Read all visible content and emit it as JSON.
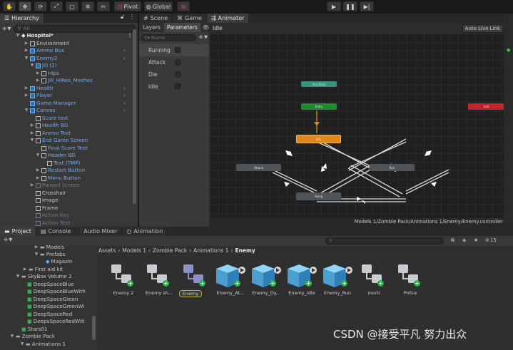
{
  "toolbar": {
    "pivot": "Pivot",
    "global": "Global"
  },
  "hierarchy": {
    "title": "Hierarchy",
    "search_placeholder": "All",
    "scene": "Hospital*",
    "items": [
      {
        "label": "Environment"
      },
      {
        "label": "Ammo Box"
      },
      {
        "label": "Enemy2"
      },
      {
        "label": "Jill (2)"
      },
      {
        "label": "Hips"
      },
      {
        "label": "Jill_HiRes_Meshes"
      },
      {
        "label": "Health"
      },
      {
        "label": "Player"
      },
      {
        "label": "Game Manager"
      },
      {
        "label": "Canvas"
      },
      {
        "label": "Score text"
      },
      {
        "label": "Health BG"
      },
      {
        "label": "Ammo Text"
      },
      {
        "label": "End Game Screen"
      },
      {
        "label": "Final Score Text"
      },
      {
        "label": "Header BG"
      },
      {
        "label": "Text (TMP)"
      },
      {
        "label": "Restart Button"
      },
      {
        "label": "Menu Button"
      },
      {
        "label": "Paused Screen"
      },
      {
        "label": "Crosshair"
      },
      {
        "label": "Image"
      },
      {
        "label": "Frame"
      },
      {
        "label": "Action Key"
      },
      {
        "label": "Action Text"
      }
    ]
  },
  "center_tabs": {
    "scene": "Scene",
    "game": "Game",
    "animator": "Animator"
  },
  "animator": {
    "layers_tab": "Layers",
    "parameters_tab": "Parameters",
    "name_placeholder": "Name",
    "parameters": [
      {
        "name": "Running"
      },
      {
        "name": "Attack"
      },
      {
        "name": "Die"
      },
      {
        "name": "Idle"
      }
    ],
    "breadcrumb": "Idle",
    "auto_live_link": "Auto Live Link",
    "states": {
      "any": "Any State",
      "entry": "Entry",
      "exit": "Exit",
      "idle": "Idle",
      "attack": "Attack",
      "run": "Run",
      "dying": "Dying"
    },
    "path": "Models 1/Zombie Pack/Animations 1/Enemy/Enemy.controller"
  },
  "bottom_tabs": {
    "project": "Project",
    "console": "Console",
    "audio_mixer": "Audio Mixer",
    "animation": "Animation"
  },
  "project": {
    "eye_count": "15",
    "breadcrumbs": [
      "Assets",
      "Models 1",
      "Zombie Pack",
      "Animations 1",
      "Enemy"
    ],
    "tree": [
      {
        "label": "Models"
      },
      {
        "label": "Prefabs"
      },
      {
        "label": "Magazin"
      },
      {
        "label": "First aid kit"
      },
      {
        "label": "SkyBox Volume 2"
      },
      {
        "label": "DeepSpaceBlue"
      },
      {
        "label": "DeepSpaceBlueWith"
      },
      {
        "label": "DeepSpaceGreen"
      },
      {
        "label": "DeepSpaceGreenWi"
      },
      {
        "label": "DeepSpaceRed"
      },
      {
        "label": "DeepsSpaceRedWitl"
      },
      {
        "label": "Stars01"
      },
      {
        "label": "Zombie Pack"
      },
      {
        "label": "Animations 1"
      }
    ],
    "assets": [
      {
        "label": "Enemy 2",
        "kind": "controller"
      },
      {
        "label": "Enemy sh...",
        "kind": "controller"
      },
      {
        "label": "Enemy",
        "kind": "controller-selected"
      },
      {
        "label": "Enemy_At...",
        "kind": "model"
      },
      {
        "label": "Enemy_Dy...",
        "kind": "model"
      },
      {
        "label": "Enemy_Idle",
        "kind": "model"
      },
      {
        "label": "Enemy_Run",
        "kind": "model"
      },
      {
        "label": "morti",
        "kind": "controller"
      },
      {
        "label": "Police",
        "kind": "controller"
      }
    ]
  },
  "watermark": "CSDN @接受平凡 努力出众"
}
